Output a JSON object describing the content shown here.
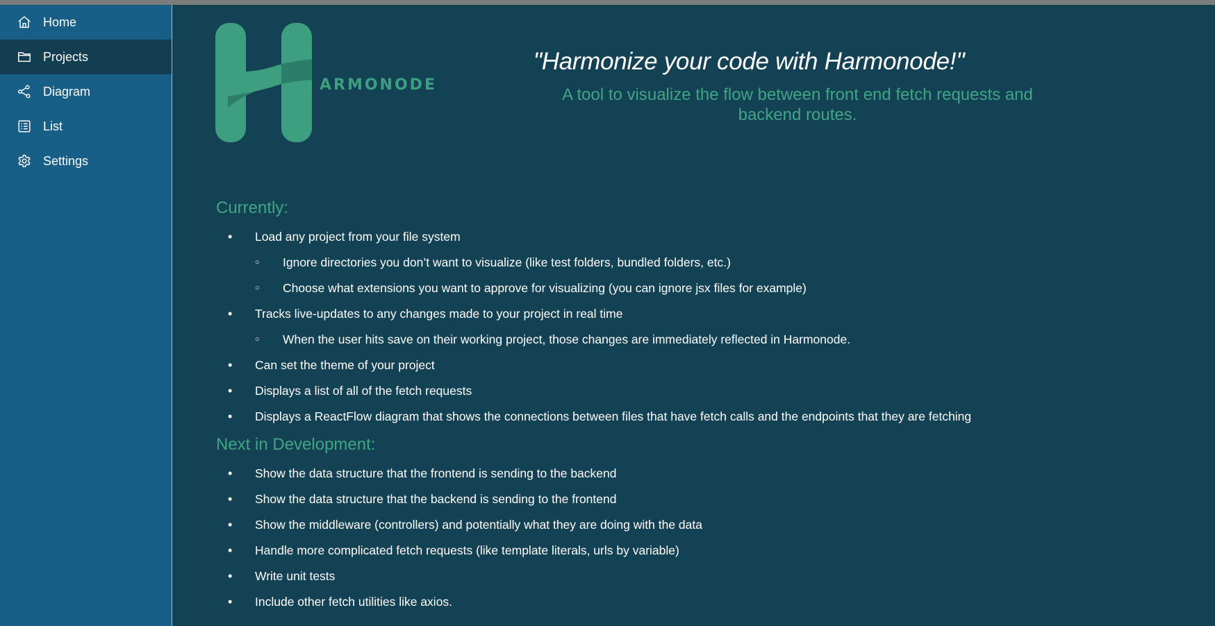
{
  "sidebar": {
    "items": [
      {
        "label": "Home",
        "icon": "home-icon",
        "active": false
      },
      {
        "label": "Projects",
        "icon": "folder-icon",
        "active": true
      },
      {
        "label": "Diagram",
        "icon": "diagram-icon",
        "active": false
      },
      {
        "label": "List",
        "icon": "list-icon",
        "active": false
      },
      {
        "label": "Settings",
        "icon": "gear-icon",
        "active": false
      }
    ]
  },
  "header": {
    "logo_text": "ARMONODE",
    "tagline": "\"Harmonize your code with Harmonode!\"",
    "subtitle": "A tool to visualize the flow between front end fetch requests and backend routes."
  },
  "currently": {
    "title": "Currently:",
    "items": [
      {
        "text": "Load any project from your file system",
        "level": 1
      },
      {
        "text": "Ignore directories you don’t want to visualize (like test folders, bundled folders, etc.)",
        "level": 2
      },
      {
        "text": "Choose what extensions you want to approve for visualizing (you can ignore jsx files for example)",
        "level": 2
      },
      {
        "text": "Tracks live-updates to any changes made to your project in real time",
        "level": 1
      },
      {
        "text": "When the user hits save on their working project, those changes are immediately reflected in Harmonode.",
        "level": 2
      },
      {
        "text": "Can set the theme of your project",
        "level": 1
      },
      {
        "text": "Displays a list of all of the fetch requests",
        "level": 1
      },
      {
        "text": "Displays a ReactFlow diagram that shows the connections between files that have fetch calls and the endpoints that they are fetching",
        "level": 1
      }
    ]
  },
  "next": {
    "title": "Next in Development:",
    "items": [
      {
        "text": "Show the data structure that the frontend is sending to the backend",
        "level": 1
      },
      {
        "text": "Show the data structure that the backend is sending to the frontend",
        "level": 1
      },
      {
        "text": "Show the middleware (controllers) and potentially what they are doing with the data",
        "level": 1
      },
      {
        "text": "Handle more complicated fetch requests (like template literals, urls by variable)",
        "level": 1
      },
      {
        "text": "Write unit tests",
        "level": 1
      },
      {
        "text": "Include other fetch utilities like axios.",
        "level": 1
      }
    ]
  },
  "colors": {
    "sidebar_bg": "#175f87",
    "sidebar_active_bg": "#133e51",
    "main_bg": "#134255",
    "accent_green": "#3fa584",
    "text": "#ffffff"
  }
}
